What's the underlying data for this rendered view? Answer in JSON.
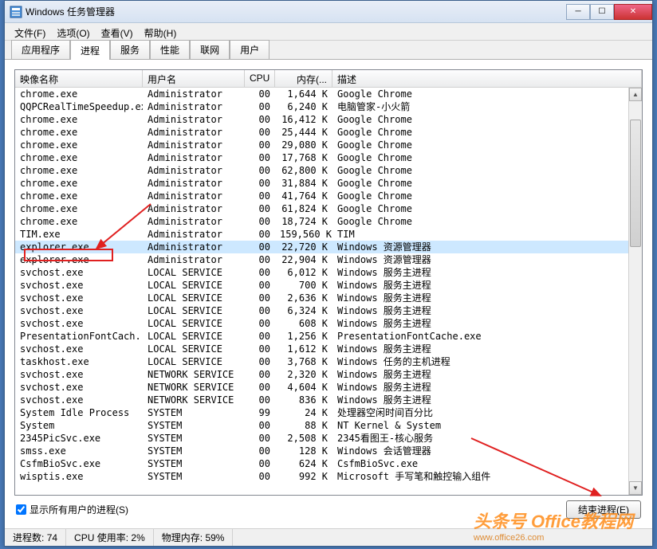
{
  "window": {
    "title": "Windows 任务管理器"
  },
  "menu": {
    "file": "文件(F)",
    "options": "选项(O)",
    "view": "查看(V)",
    "help": "帮助(H)"
  },
  "tabs": {
    "apps": "应用程序",
    "processes": "进程",
    "services": "服务",
    "performance": "性能",
    "networking": "联网",
    "users": "用户"
  },
  "columns": {
    "image": "映像名称",
    "user": "用户名",
    "cpu": "CPU",
    "memory": "内存(...",
    "desc": "描述"
  },
  "rows": [
    {
      "image": "chrome.exe",
      "user": "Administrator",
      "cpu": "00",
      "mem": "1,644 K",
      "desc": "Google Chrome",
      "sel": false
    },
    {
      "image": "QQPCRealTimeSpeedup.exe",
      "user": "Administrator",
      "cpu": "00",
      "mem": "6,240 K",
      "desc": "电脑管家-小火箭",
      "sel": false
    },
    {
      "image": "chrome.exe",
      "user": "Administrator",
      "cpu": "00",
      "mem": "16,412 K",
      "desc": "Google Chrome",
      "sel": false
    },
    {
      "image": "chrome.exe",
      "user": "Administrator",
      "cpu": "00",
      "mem": "25,444 K",
      "desc": "Google Chrome",
      "sel": false
    },
    {
      "image": "chrome.exe",
      "user": "Administrator",
      "cpu": "00",
      "mem": "29,080 K",
      "desc": "Google Chrome",
      "sel": false
    },
    {
      "image": "chrome.exe",
      "user": "Administrator",
      "cpu": "00",
      "mem": "17,768 K",
      "desc": "Google Chrome",
      "sel": false
    },
    {
      "image": "chrome.exe",
      "user": "Administrator",
      "cpu": "00",
      "mem": "62,800 K",
      "desc": "Google Chrome",
      "sel": false
    },
    {
      "image": "chrome.exe",
      "user": "Administrator",
      "cpu": "00",
      "mem": "31,884 K",
      "desc": "Google Chrome",
      "sel": false
    },
    {
      "image": "chrome.exe",
      "user": "Administrator",
      "cpu": "00",
      "mem": "41,764 K",
      "desc": "Google Chrome",
      "sel": false
    },
    {
      "image": "chrome.exe",
      "user": "Administrator",
      "cpu": "00",
      "mem": "61,824 K",
      "desc": "Google Chrome",
      "sel": false
    },
    {
      "image": "chrome.exe",
      "user": "Administrator",
      "cpu": "00",
      "mem": "18,724 K",
      "desc": "Google Chrome",
      "sel": false
    },
    {
      "image": "TIM.exe",
      "user": "Administrator",
      "cpu": "00",
      "mem": "159,560 K",
      "desc": "TIM",
      "sel": false
    },
    {
      "image": "explorer.exe",
      "user": "Administrator",
      "cpu": "00",
      "mem": "22,720 K",
      "desc": "Windows 资源管理器",
      "sel": true
    },
    {
      "image": "explorer.exe",
      "user": "Administrator",
      "cpu": "00",
      "mem": "22,904 K",
      "desc": "Windows 资源管理器",
      "sel": false
    },
    {
      "image": "svchost.exe",
      "user": "LOCAL SERVICE",
      "cpu": "00",
      "mem": "6,012 K",
      "desc": "Windows 服务主进程",
      "sel": false
    },
    {
      "image": "svchost.exe",
      "user": "LOCAL SERVICE",
      "cpu": "00",
      "mem": "700 K",
      "desc": "Windows 服务主进程",
      "sel": false
    },
    {
      "image": "svchost.exe",
      "user": "LOCAL SERVICE",
      "cpu": "00",
      "mem": "2,636 K",
      "desc": "Windows 服务主进程",
      "sel": false
    },
    {
      "image": "svchost.exe",
      "user": "LOCAL SERVICE",
      "cpu": "00",
      "mem": "6,324 K",
      "desc": "Windows 服务主进程",
      "sel": false
    },
    {
      "image": "svchost.exe",
      "user": "LOCAL SERVICE",
      "cpu": "00",
      "mem": "608 K",
      "desc": "Windows 服务主进程",
      "sel": false
    },
    {
      "image": "PresentationFontCach...",
      "user": "LOCAL SERVICE",
      "cpu": "00",
      "mem": "1,256 K",
      "desc": "PresentationFontCache.exe",
      "sel": false
    },
    {
      "image": "svchost.exe",
      "user": "LOCAL SERVICE",
      "cpu": "00",
      "mem": "1,612 K",
      "desc": "Windows 服务主进程",
      "sel": false
    },
    {
      "image": "taskhost.exe",
      "user": "LOCAL SERVICE",
      "cpu": "00",
      "mem": "3,768 K",
      "desc": "Windows 任务的主机进程",
      "sel": false
    },
    {
      "image": "svchost.exe",
      "user": "NETWORK SERVICE",
      "cpu": "00",
      "mem": "2,320 K",
      "desc": "Windows 服务主进程",
      "sel": false
    },
    {
      "image": "svchost.exe",
      "user": "NETWORK SERVICE",
      "cpu": "00",
      "mem": "4,604 K",
      "desc": "Windows 服务主进程",
      "sel": false
    },
    {
      "image": "svchost.exe",
      "user": "NETWORK SERVICE",
      "cpu": "00",
      "mem": "836 K",
      "desc": "Windows 服务主进程",
      "sel": false
    },
    {
      "image": "System Idle Process",
      "user": "SYSTEM",
      "cpu": "99",
      "mem": "24 K",
      "desc": "处理器空闲时间百分比",
      "sel": false
    },
    {
      "image": "System",
      "user": "SYSTEM",
      "cpu": "00",
      "mem": "88 K",
      "desc": "NT Kernel & System",
      "sel": false
    },
    {
      "image": "2345PicSvc.exe",
      "user": "SYSTEM",
      "cpu": "00",
      "mem": "2,508 K",
      "desc": "2345看图王-核心服务",
      "sel": false
    },
    {
      "image": "smss.exe",
      "user": "SYSTEM",
      "cpu": "00",
      "mem": "128 K",
      "desc": "Windows 会话管理器",
      "sel": false
    },
    {
      "image": "CsfmBioSvc.exe",
      "user": "SYSTEM",
      "cpu": "00",
      "mem": "624 K",
      "desc": "CsfmBioSvc.exe",
      "sel": false
    },
    {
      "image": "wisptis.exe",
      "user": "SYSTEM",
      "cpu": "00",
      "mem": "992 K",
      "desc": "Microsoft 手写笔和触控输入组件",
      "sel": false
    }
  ],
  "bottom": {
    "show_all_label": "显示所有用户的进程(S)",
    "end_process": "结束进程(E)"
  },
  "status": {
    "procs_label": "进程数:",
    "procs_value": "74",
    "cpu_label": "CPU 使用率:",
    "cpu_value": "2%",
    "mem_label": "物理内存:",
    "mem_value": "59%"
  },
  "watermark": {
    "line1": "头条号 Office教程网",
    "line2": "www.office26.com"
  }
}
